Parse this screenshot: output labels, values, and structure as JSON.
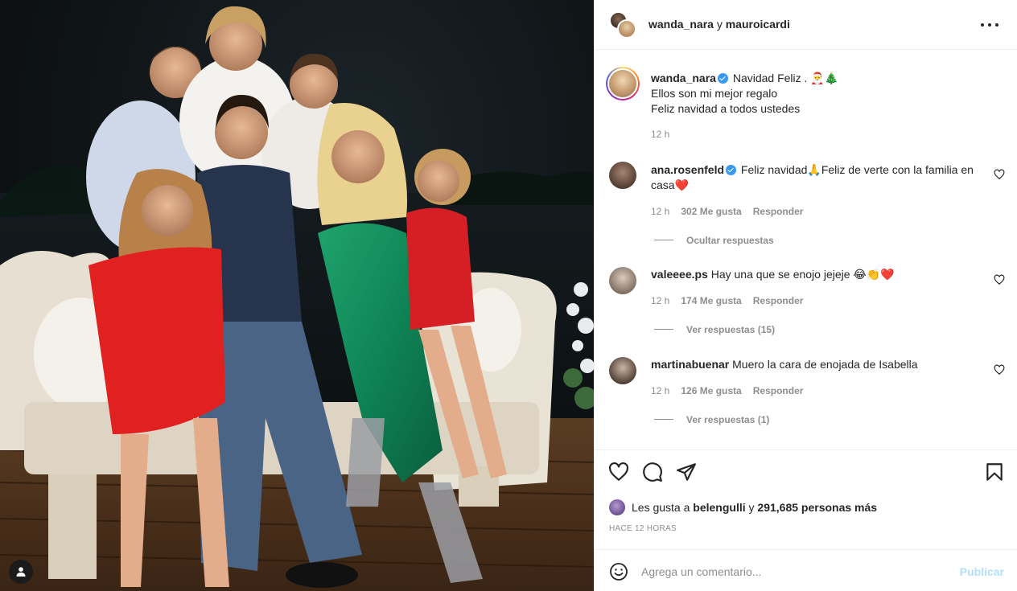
{
  "header": {
    "user1": "wanda_nara",
    "conjunction": "y",
    "user2": "mauroicardi"
  },
  "caption": {
    "username": "wanda_nara",
    "line1": "Navidad Feliz .",
    "line1_emoji": "🎅🎄",
    "line2": "Ellos son mi mejor regalo",
    "line3": "Feliz navidad a todos ustedes",
    "time": "12 h"
  },
  "comments": [
    {
      "username": "ana.rosenfeld",
      "verified": true,
      "text": "Feliz navidad🙏Feliz de verte con la familia en casa❤️",
      "time": "12 h",
      "likes": "302 Me gusta",
      "reply_label": "Responder",
      "replies_label": "Ocultar respuestas"
    },
    {
      "username": "valeeee.ps",
      "verified": false,
      "text": "Hay una que se enojo jejeje 😂👏❤️",
      "time": "12 h",
      "likes": "174 Me gusta",
      "reply_label": "Responder",
      "replies_label": "Ver respuestas (15)"
    },
    {
      "username": "martinabuenar",
      "verified": false,
      "text": "Muero la cara de enojada de Isabella",
      "time": "12 h",
      "likes": "126 Me gusta",
      "reply_label": "Responder",
      "replies_label": "Ver respuestas (1)"
    }
  ],
  "likes": {
    "prefix": "Les gusta a",
    "user": "belengulli",
    "middle": "y",
    "count": "291,685 personas más"
  },
  "posted_ago": "HACE 12 HORAS",
  "composer": {
    "placeholder": "Agrega un comentario...",
    "publish_label": "Publicar"
  },
  "colors": {
    "verified": "#3897f0",
    "publish_disabled": "#b2dffc",
    "muted": "#8e8e8e",
    "text": "#262626"
  },
  "icons": [
    "tag-user-icon",
    "more-options-icon",
    "like-heart-icon",
    "comment-icon",
    "share-icon",
    "save-bookmark-icon",
    "emoji-icon"
  ]
}
